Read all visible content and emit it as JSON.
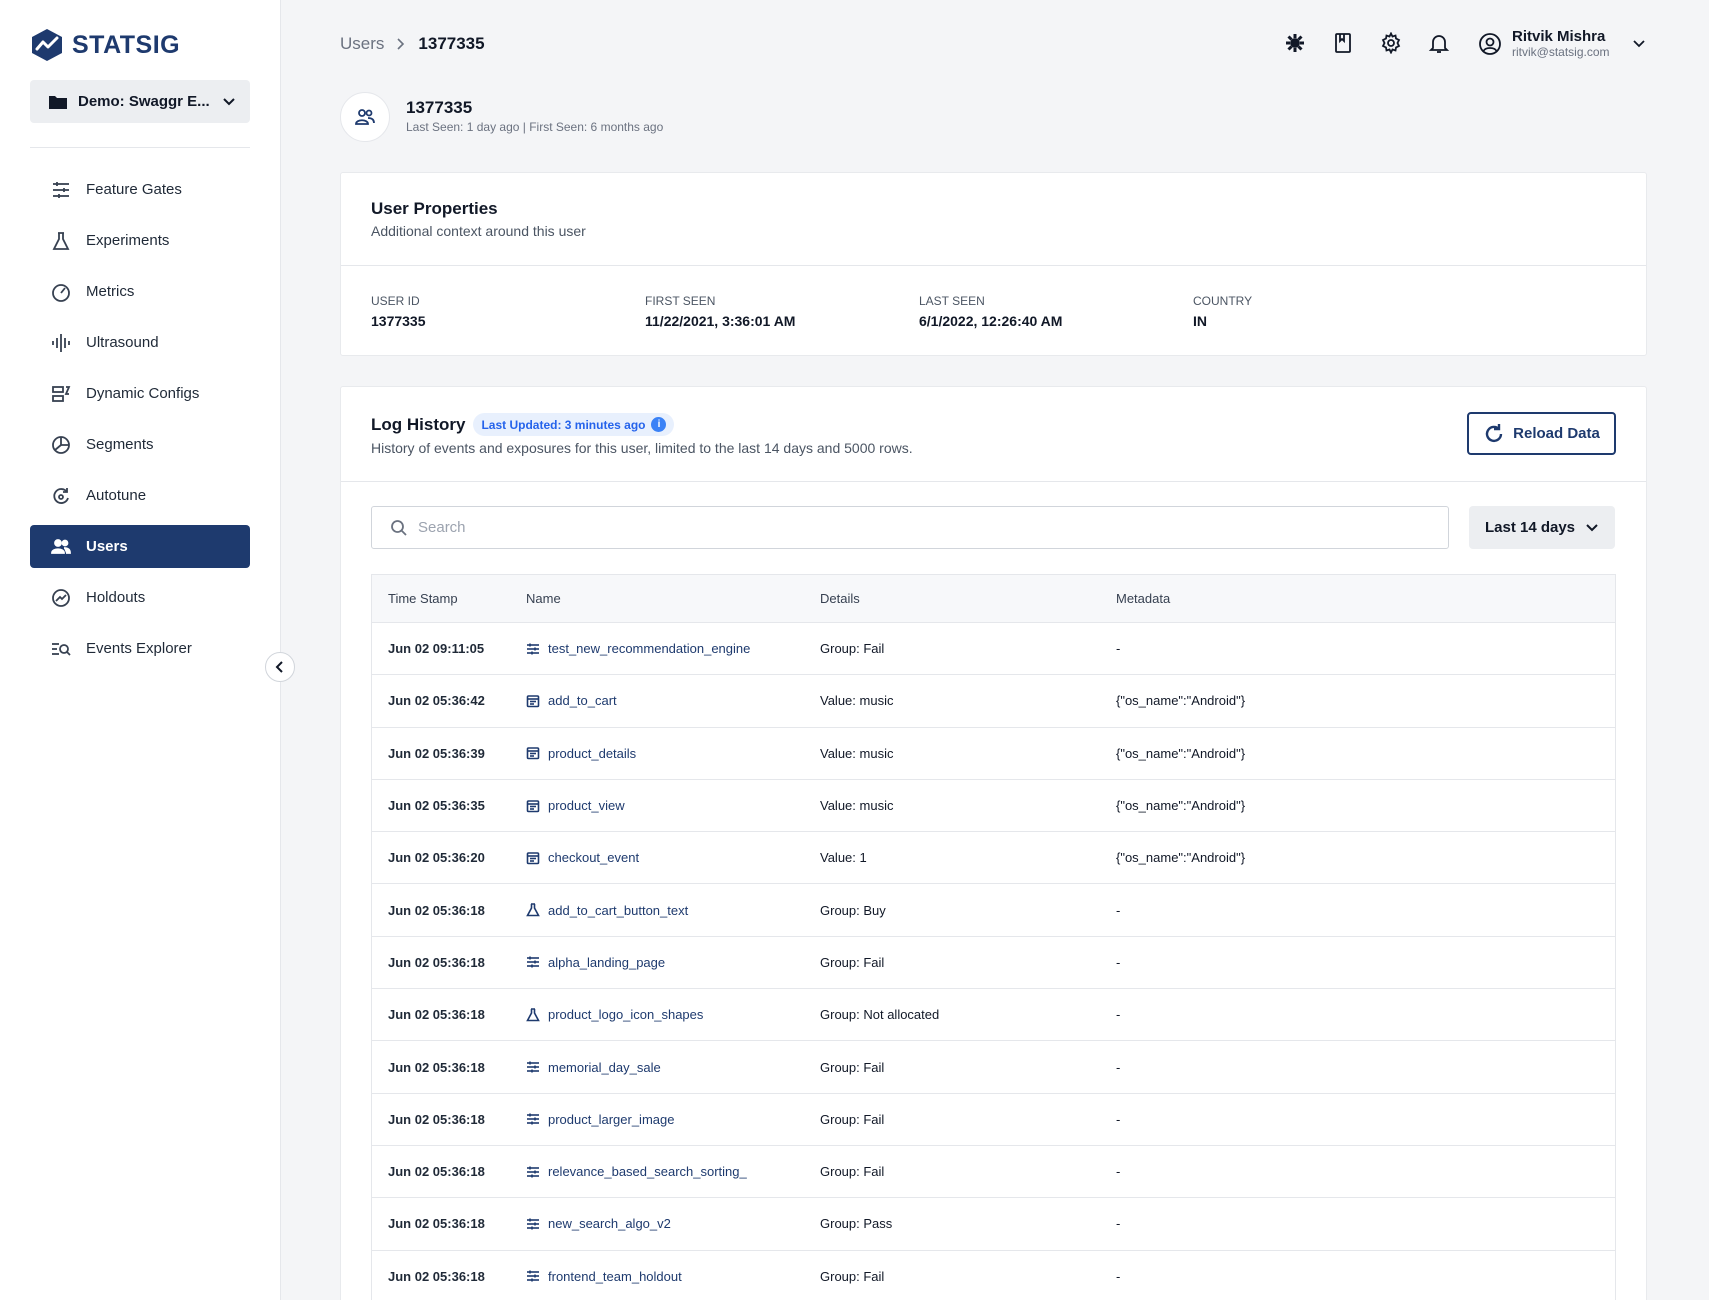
{
  "brand": {
    "name": "STATSIG"
  },
  "project": {
    "name": "Demo: Swaggr E..."
  },
  "sidebar": {
    "items": [
      {
        "label": "Feature Gates",
        "icon": "feature-gates-icon"
      },
      {
        "label": "Experiments",
        "icon": "flask-icon"
      },
      {
        "label": "Metrics",
        "icon": "gauge-icon"
      },
      {
        "label": "Ultrasound",
        "icon": "waveform-icon"
      },
      {
        "label": "Dynamic Configs",
        "icon": "config-icon"
      },
      {
        "label": "Segments",
        "icon": "segments-icon"
      },
      {
        "label": "Autotune",
        "icon": "autotune-icon"
      },
      {
        "label": "Users",
        "icon": "users-icon",
        "active": true
      },
      {
        "label": "Holdouts",
        "icon": "holdouts-icon"
      },
      {
        "label": "Events Explorer",
        "icon": "events-explorer-icon"
      }
    ]
  },
  "breadcrumb": {
    "root": "Users",
    "current": "1377335"
  },
  "user_menu": {
    "name": "Ritvik Mishra",
    "email": "ritvik@statsig.com"
  },
  "user": {
    "id_title": "1377335",
    "seen_summary": "Last Seen: 1 day ago | First Seen: 6 months ago"
  },
  "properties": {
    "title": "User Properties",
    "subtitle": "Additional context around this user",
    "fields": [
      {
        "label": "USER ID",
        "value": "1377335"
      },
      {
        "label": "FIRST SEEN",
        "value": "11/22/2021, 3:36:01 AM"
      },
      {
        "label": "LAST SEEN",
        "value": "6/1/2022, 12:26:40 AM"
      },
      {
        "label": "COUNTRY",
        "value": "IN"
      }
    ]
  },
  "log": {
    "title": "Log History",
    "badge": "Last Updated: 3 minutes ago",
    "subtitle": "History of events and exposures for this user, limited to the last 14 days and 5000 rows.",
    "reload_label": "Reload Data",
    "search_placeholder": "Search",
    "range_label": "Last 14 days",
    "columns": [
      "Time Stamp",
      "Name",
      "Details",
      "Metadata"
    ],
    "rows": [
      {
        "time": "Jun 02 09:11:05",
        "type": "gate",
        "name": "test_new_recommendation_engine",
        "details": "Group: Fail",
        "metadata": "-"
      },
      {
        "time": "Jun 02 05:36:42",
        "type": "event",
        "name": "add_to_cart",
        "details": "Value: music",
        "metadata": "{\"os_name\":\"Android\"}"
      },
      {
        "time": "Jun 02 05:36:39",
        "type": "event",
        "name": "product_details",
        "details": "Value: music",
        "metadata": "{\"os_name\":\"Android\"}"
      },
      {
        "time": "Jun 02 05:36:35",
        "type": "event",
        "name": "product_view",
        "details": "Value: music",
        "metadata": "{\"os_name\":\"Android\"}"
      },
      {
        "time": "Jun 02 05:36:20",
        "type": "event",
        "name": "checkout_event",
        "details": "Value: 1",
        "metadata": "{\"os_name\":\"Android\"}"
      },
      {
        "time": "Jun 02 05:36:18",
        "type": "experiment",
        "name": "add_to_cart_button_text",
        "details": "Group: Buy",
        "metadata": "-"
      },
      {
        "time": "Jun 02 05:36:18",
        "type": "gate",
        "name": "alpha_landing_page",
        "details": "Group: Fail",
        "metadata": "-"
      },
      {
        "time": "Jun 02 05:36:18",
        "type": "experiment",
        "name": "product_logo_icon_shapes",
        "details": "Group: Not allocated",
        "metadata": "-"
      },
      {
        "time": "Jun 02 05:36:18",
        "type": "gate",
        "name": "memorial_day_sale",
        "details": "Group: Fail",
        "metadata": "-"
      },
      {
        "time": "Jun 02 05:36:18",
        "type": "gate",
        "name": "product_larger_image",
        "details": "Group: Fail",
        "metadata": "-"
      },
      {
        "time": "Jun 02 05:36:18",
        "type": "gate",
        "name": "relevance_based_search_sorting_",
        "details": "Group: Fail",
        "metadata": "-"
      },
      {
        "time": "Jun 02 05:36:18",
        "type": "gate",
        "name": "new_search_algo_v2",
        "details": "Group: Pass",
        "metadata": "-"
      },
      {
        "time": "Jun 02 05:36:18",
        "type": "gate",
        "name": "frontend_team_holdout",
        "details": "Group: Fail",
        "metadata": "-"
      }
    ]
  },
  "colors": {
    "brand": "#1e3a6e",
    "accent": "#2563eb",
    "background": "#f4f5f7"
  }
}
